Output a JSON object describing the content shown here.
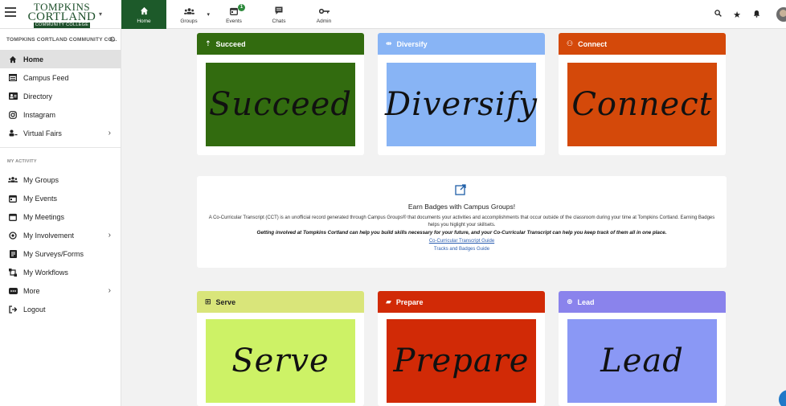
{
  "header": {
    "logo_line1": "TOMPKINS",
    "logo_line2": "CORTLAND",
    "logo_line3": "COMMUNITY COLLEGE",
    "nav": [
      {
        "label": "Home",
        "icon": "home-icon",
        "active": true
      },
      {
        "label": "Groups",
        "icon": "groups-icon"
      },
      {
        "label": "Events",
        "icon": "calendar-icon",
        "badge": "1"
      },
      {
        "label": "Chats",
        "icon": "chat-icon"
      },
      {
        "label": "Admin",
        "icon": "key-icon"
      }
    ],
    "right_icons": [
      "search-icon",
      "star-icon",
      "bell-icon",
      "avatar"
    ]
  },
  "sidebar": {
    "org_name": "TOMPKINS CORTLAND COMMUNITY CO...",
    "items": [
      {
        "label": "Home",
        "icon": "home-icon"
      },
      {
        "label": "Campus Feed",
        "icon": "feed-icon"
      },
      {
        "label": "Directory",
        "icon": "directory-icon"
      },
      {
        "label": "Instagram",
        "icon": "instagram-icon"
      },
      {
        "label": "Virtual Fairs",
        "icon": "virtual-fairs-icon"
      }
    ],
    "section_label": "MY ACTIVITY",
    "activity_items": [
      {
        "label": "My Groups",
        "icon": "groups-icon"
      },
      {
        "label": "My Events",
        "icon": "calendar-icon"
      },
      {
        "label": "My Meetings",
        "icon": "meetings-icon"
      },
      {
        "label": "My Involvement",
        "icon": "involvement-icon"
      },
      {
        "label": "My Surveys/Forms",
        "icon": "surveys-icon"
      },
      {
        "label": "My Workflows",
        "icon": "workflows-icon"
      },
      {
        "label": "More",
        "icon": "more-icon"
      },
      {
        "label": "Logout",
        "icon": "logout-icon"
      }
    ]
  },
  "cards": {
    "succeed": {
      "header": "Succeed",
      "image_text": "Succeed",
      "header_color": "#326b0f",
      "image_color": "#326b0f"
    },
    "diversify": {
      "header": "Diversify",
      "image_text": "Diversify",
      "header_color": "#88b4f5",
      "image_color": "#88b4f5"
    },
    "connect": {
      "header": "Connect",
      "image_text": "Connect",
      "header_color": "#d4490a",
      "image_color": "#d4490a"
    },
    "serve": {
      "header": "Serve",
      "image_text": "Serve",
      "header_color": "#d9e57a",
      "image_color": "#cdf266"
    },
    "prepare": {
      "header": "Prepare",
      "image_text": "Prepare",
      "header_color": "#d12a06",
      "image_color": "#d12a06"
    },
    "lead": {
      "header": "Lead",
      "image_text": "Lead",
      "header_color": "#8a83ec",
      "image_color": "#8a98f5"
    }
  },
  "badges_panel": {
    "title": "Earn Badges with Campus Groups!",
    "description": "A Co-Curricular Transcript (CCT) is an unofficial record generated through Campus Groups® that documents your activities and accomplishments that occur outside of the classroom during your time at Tompkins Cortland. Earning Badges helps you higlight your skillsets.",
    "emphasis": "Getting involved at Tompkins Cortland can help you build skills necessary for your future, and your Co-Curricular Transcript can help you keep track of them all in one place.",
    "link1": "Co-Curricular Transcript Guide",
    "link2": "Tracks and Badges Guide"
  },
  "colors": {
    "brand_green": "#1d5a2a",
    "link_blue": "#2a5db0"
  }
}
